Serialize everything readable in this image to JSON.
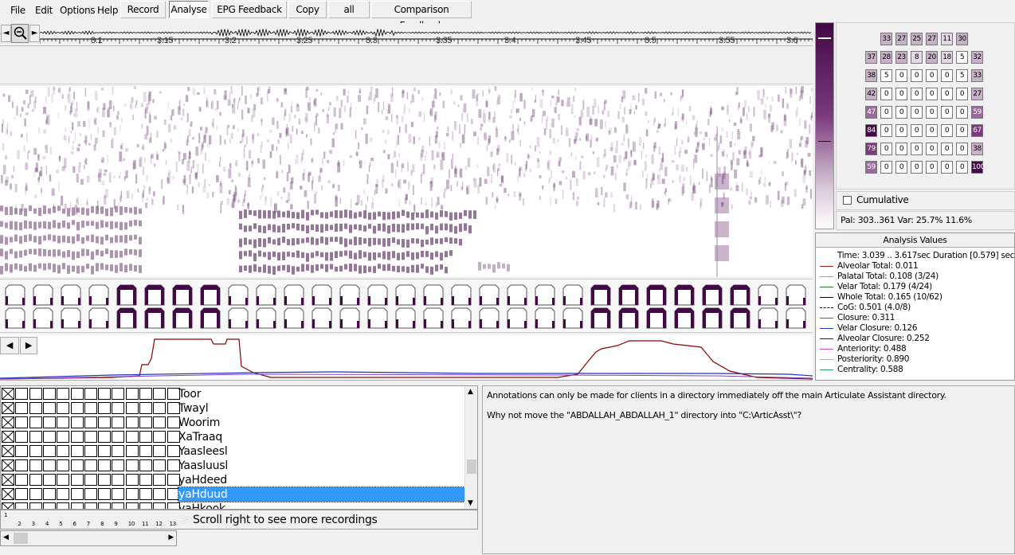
{
  "menu": {
    "file": "File",
    "edit": "Edit",
    "options": "Options",
    "help": "Help"
  },
  "tabs": [
    {
      "label": "Record",
      "active": false
    },
    {
      "label": "Analyse",
      "active": true
    },
    {
      "label": "EPG Feedback",
      "active": false
    },
    {
      "label": "Copy",
      "active": false
    },
    {
      "label": "all",
      "active": false
    },
    {
      "label": "Comparison Feedback",
      "active": false
    }
  ],
  "toolbar": {
    "nav_left": "◄",
    "nav_right": "►"
  },
  "ruler": {
    "ticks": [
      "3.1",
      "3.15",
      "3.2",
      "3.25",
      "3.3",
      "3.35",
      "3.4",
      "3.45",
      "3.5",
      "3.55",
      "3.6"
    ]
  },
  "epg_grid": [
    [
      "33",
      "27",
      "25",
      "27",
      "11",
      "30"
    ],
    [
      "37",
      "28",
      "23",
      "8",
      "20",
      "18",
      "5",
      "32"
    ],
    [
      "38",
      "5",
      "0",
      "0",
      "0",
      "0",
      "5",
      "33"
    ],
    [
      "42",
      "0",
      "0",
      "0",
      "0",
      "0",
      "0",
      "27"
    ],
    [
      "47",
      "0",
      "0",
      "0",
      "0",
      "0",
      "0",
      "59"
    ],
    [
      "84",
      "0",
      "0",
      "0",
      "0",
      "0",
      "0",
      "67"
    ],
    [
      "79",
      "0",
      "0",
      "0",
      "0",
      "0",
      "0",
      "38"
    ],
    [
      "59",
      "0",
      "0",
      "0",
      "0",
      "0",
      "0",
      "100"
    ]
  ],
  "cumulative_label": "Cumulative",
  "pal_text": "Pal: 303..361  Var: 25.7%  11.6%",
  "analysis": {
    "title": "Analysis Values",
    "rows": [
      {
        "text": "Time: 3.039 .. 3.617sec Duration [0.579] sec",
        "color": ""
      },
      {
        "text": "Alveolar Total: 0.011",
        "color": "#b02020"
      },
      {
        "text": "Palatal Total: 0.108 (3/24)",
        "color": "#e09050"
      },
      {
        "text": "Velar Total: 0.179 (4/24)",
        "color": "#208020"
      },
      {
        "text": "Whole Total: 0.165 (10/62)",
        "color": "#000000"
      },
      {
        "text": "CoG: 0.501 (4.0/8)",
        "color": "dash"
      },
      {
        "text": "Closure: 0.311",
        "color": "#8040c0"
      },
      {
        "text": "Velar Closure: 0.126",
        "color": "#2030c0"
      },
      {
        "text": "Alveolar Closure: 0.252",
        "color": "#800000"
      },
      {
        "text": "Anteriority: 0.488",
        "color": "#e040e0"
      },
      {
        "text": "Posteriority: 0.890",
        "color": "#40e0e0"
      },
      {
        "text": "Centrality: 0.588",
        "color": "#20a060"
      }
    ]
  },
  "recordings": [
    {
      "name": "Toor",
      "selected": false
    },
    {
      "name": "Twayl",
      "selected": false
    },
    {
      "name": "Woorim",
      "selected": false
    },
    {
      "name": "XaTraaq",
      "selected": false
    },
    {
      "name": "Yaasleesl",
      "selected": false
    },
    {
      "name": "Yaasluusl",
      "selected": false
    },
    {
      "name": "yaHdeed",
      "selected": false
    },
    {
      "name": "yaHduud",
      "selected": true
    },
    {
      "name": "yaHkook",
      "selected": false
    }
  ],
  "column_numbers": [
    "1",
    "2",
    "3",
    "4",
    "5",
    "6",
    "7",
    "8",
    "9",
    "10",
    "11",
    "12",
    "13"
  ],
  "scroll_hint": "Scroll right to see more recordings",
  "annotation": {
    "line1": "Annotations can only be made for clients in a directory immediately off the main Articulate Assistant directory.",
    "line2": "Why not move the \"ABDALLAH_ABDALLAH_1\" directory into \"C:\\ArticAsst\\\"?"
  },
  "colors": {
    "accent": "#3399ff",
    "epg_dark": "#430846",
    "spectro": "#7a4a80"
  }
}
